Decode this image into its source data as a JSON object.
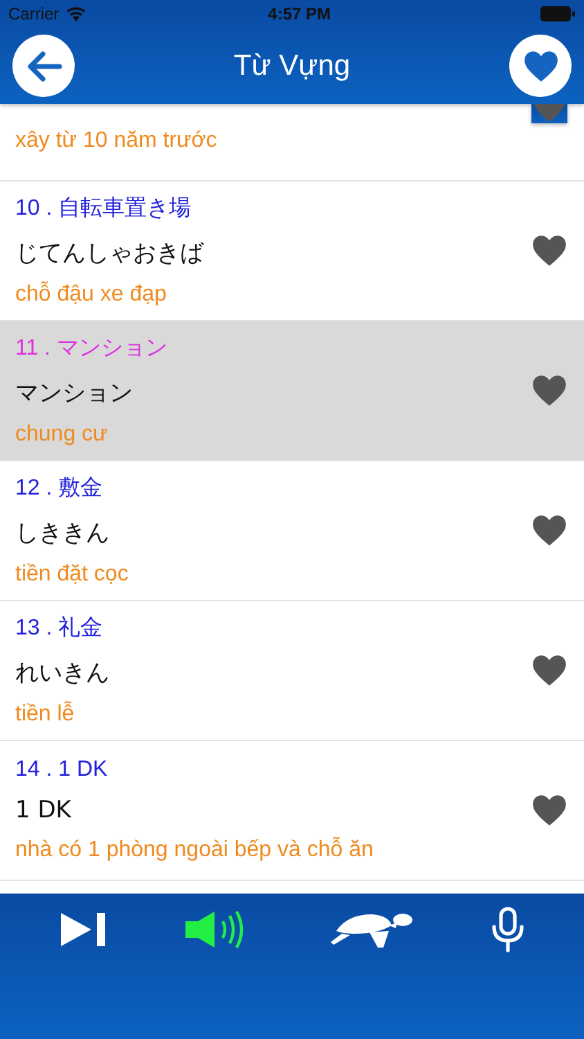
{
  "status_bar": {
    "carrier": "Carrier",
    "time": "4:57 PM"
  },
  "header": {
    "title": "Từ Vựng"
  },
  "words": [
    {
      "kind": "partial",
      "meaning": "xây từ 10 năm trước",
      "selected": false
    },
    {
      "kind": "full",
      "title": "10 . 自転車置き場",
      "reading": "じてんしゃおきば",
      "meaning": "chỗ đậu xe đạp",
      "selected": false
    },
    {
      "kind": "full",
      "title": "11 . マンション",
      "reading": "マンション",
      "meaning": "chung cư",
      "selected": true
    },
    {
      "kind": "full",
      "title": "12 . 敷金",
      "reading": "しききん",
      "meaning": "tiền đặt cọc",
      "selected": false
    },
    {
      "kind": "full",
      "title": "13 . 礼金",
      "reading": "れいきん",
      "meaning": "tiền lễ",
      "selected": false
    },
    {
      "kind": "full",
      "title": "14 . 1 DK",
      "reading": "1 DK",
      "meaning": "nhà có 1 phòng ngoài bếp và chỗ ăn",
      "selected": false
    }
  ],
  "toolbar": [
    {
      "kind": "next",
      "on": false
    },
    {
      "kind": "sound",
      "on": true
    },
    {
      "kind": "turtle",
      "on": false
    },
    {
      "kind": "mic",
      "on": false
    }
  ]
}
